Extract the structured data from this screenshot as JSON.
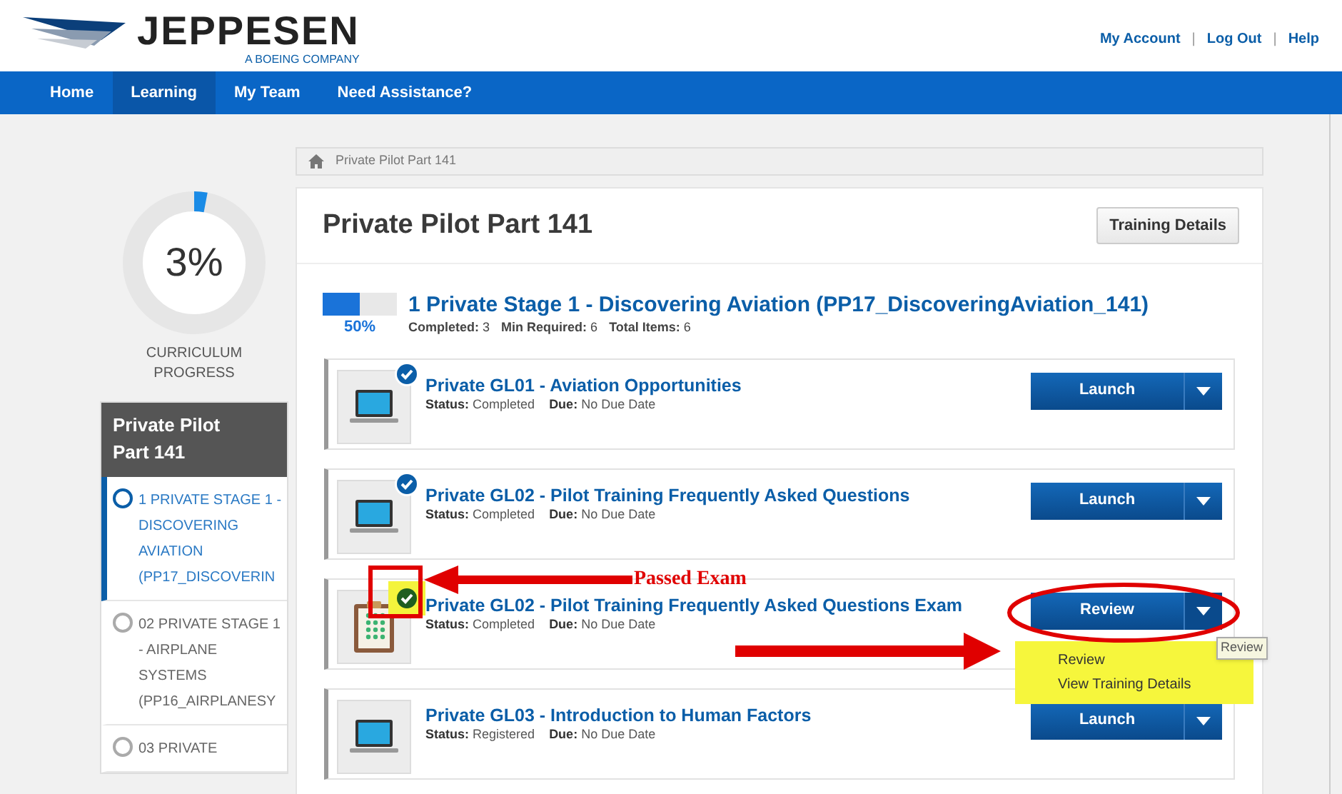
{
  "header": {
    "logo": "JEPPESEN",
    "logo_sub": "A BOEING COMPANY",
    "links": [
      "My Account",
      "Log Out",
      "Help"
    ],
    "separators": [
      "|",
      "|"
    ]
  },
  "nav": [
    {
      "label": "Home",
      "selected": false
    },
    {
      "label": "Learning",
      "selected": true
    },
    {
      "label": "My Team",
      "selected": false
    },
    {
      "label": "Need Assistance?",
      "selected": false
    }
  ],
  "breadcrumb": [
    "Private Pilot Part 141"
  ],
  "progress": {
    "reading": "3%",
    "label": "CURRICULUM PROGRESS"
  },
  "curriculum": {
    "title": "Private Pilot Part 141",
    "items": [
      {
        "label": "1 PRIVATE STAGE 1 - DISCOVERING AVIATION (PP17_DISCOVERIN",
        "selected": true
      },
      {
        "label": "02 PRIVATE STAGE 1 - AIRPLANE SYSTEMS (PP16_AIRPLANESY",
        "selected": false
      },
      {
        "label": "03 PRIVATE",
        "selected": false
      }
    ]
  },
  "page_title": "Private Pilot Part 141",
  "details_button": "Training Details",
  "stage": {
    "level": 0.5,
    "reading": "50%",
    "title": "1 Private Stage 1 - Discovering Aviation (PP17_DiscoveringAviation_141)",
    "stats": [
      {
        "label": "Completed:",
        "value": "3"
      },
      {
        "label": "Min Required:",
        "value": "6"
      },
      {
        "label": "Total Items:",
        "value": "6"
      }
    ]
  },
  "items": [
    {
      "kind": "laptop",
      "completed_mark": true,
      "highlighted": false,
      "title": "Private GL01 - Aviation Opportunities",
      "status_label": "Status:",
      "status": "Completed",
      "due_label": "Due:",
      "due": "No Due Date",
      "button": "Launch",
      "expanded": false
    },
    {
      "kind": "laptop",
      "completed_mark": true,
      "highlighted": false,
      "title": "Private GL02 - Pilot Training Frequently Asked Questions",
      "status_label": "Status:",
      "status": "Completed",
      "due_label": "Due:",
      "due": "No Due Date",
      "button": "Launch",
      "expanded": false
    },
    {
      "kind": "exam",
      "completed_mark": true,
      "highlighted": true,
      "title": "Private GL02 - Pilot Training Frequently Asked Questions Exam",
      "status_label": "Status:",
      "status": "Completed",
      "due_label": "Due:",
      "due": "No Due Date",
      "button": "Review",
      "expanded": true,
      "menu": [
        "Review",
        "View Training Details"
      ],
      "tooltip": "Review"
    },
    {
      "kind": "laptop",
      "completed_mark": false,
      "highlighted": false,
      "title": "Private GL03 - Introduction to Human Factors",
      "status_label": "Status:",
      "status": "Registered",
      "due_label": "Due:",
      "due": "No Due Date",
      "button": "Launch",
      "expanded": false
    }
  ],
  "annotation": {
    "callout": "Passed Exam"
  }
}
